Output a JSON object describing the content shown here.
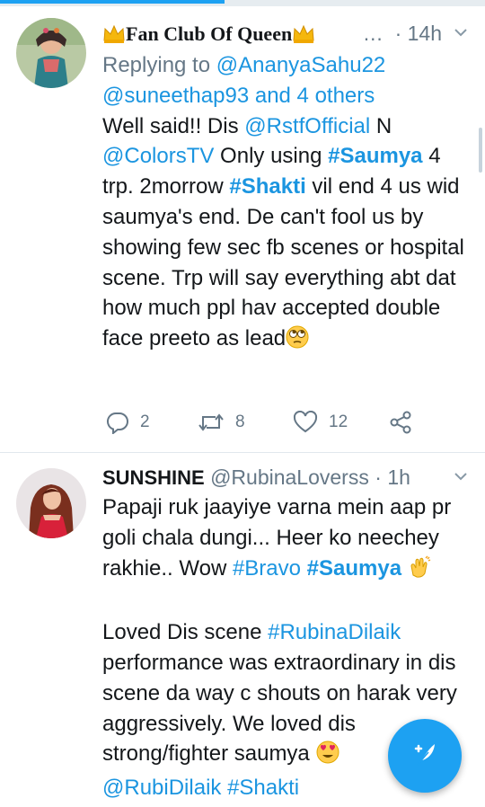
{
  "tweets": [
    {
      "display_name": "Fan Club Of Queen",
      "ellipsis": "…",
      "separator": "·",
      "time": "14h",
      "replying_prefix": "Replying to ",
      "replying_user": "@AnanyaSahu22",
      "replying_user2": "@suneethap93",
      "replying_others": "and 4 others",
      "text_parts": {
        "p1": "Well said!! Dis ",
        "mention1": "@RstfOfficial",
        "p2": " N ",
        "mention2": "@ColorsTV",
        "p3": " Only using ",
        "hashtag1": "#Saumya",
        "p4": " 4 trp. 2morrow ",
        "hashtag2": "#Shakti",
        "p5": " vil end 4 us wid saumya's end. De can't fool us by showing few sec fb scenes or hospital scene. Trp will say everything abt dat how much ppl hav accepted double face preeto as lead"
      },
      "replies": "2",
      "retweets": "8",
      "likes": "12"
    },
    {
      "display_name": "SUNSHINE",
      "handle": "@RubinaLoverss",
      "separator": "·",
      "time": "1h",
      "text_parts": {
        "p1": "Papaji ruk jaayiye varna mein aap pr goli chala dungi... Heer ko neechey rakhie.. Wow ",
        "hashtag1": "#Bravo",
        "hashtag2": "#Saumya",
        "p2": "Loved Dis scene ",
        "hashtag3": "#RubinaDilaik",
        "p3": " performance was extraordinary in dis scene da way c shouts on harak very aggressively. We loved dis strong/fighter saumya ",
        "mention1": "@RubiDilaik",
        "hashtag4": "#Shakti"
      }
    }
  ],
  "icons": {
    "crown": "crown-emoji",
    "eye_roll": "face-with-rolling-eyes-emoji",
    "clap": "clapping-hands-emoji",
    "heart_eyes": "heart-eyes-emoji",
    "reply": "reply-icon",
    "retweet": "retweet-icon",
    "like": "heart-icon",
    "share": "share-icon",
    "compose": "compose-tweet-icon"
  },
  "colors": {
    "accent": "#1da1f2",
    "link": "#1b95e0",
    "muted": "#657786"
  }
}
